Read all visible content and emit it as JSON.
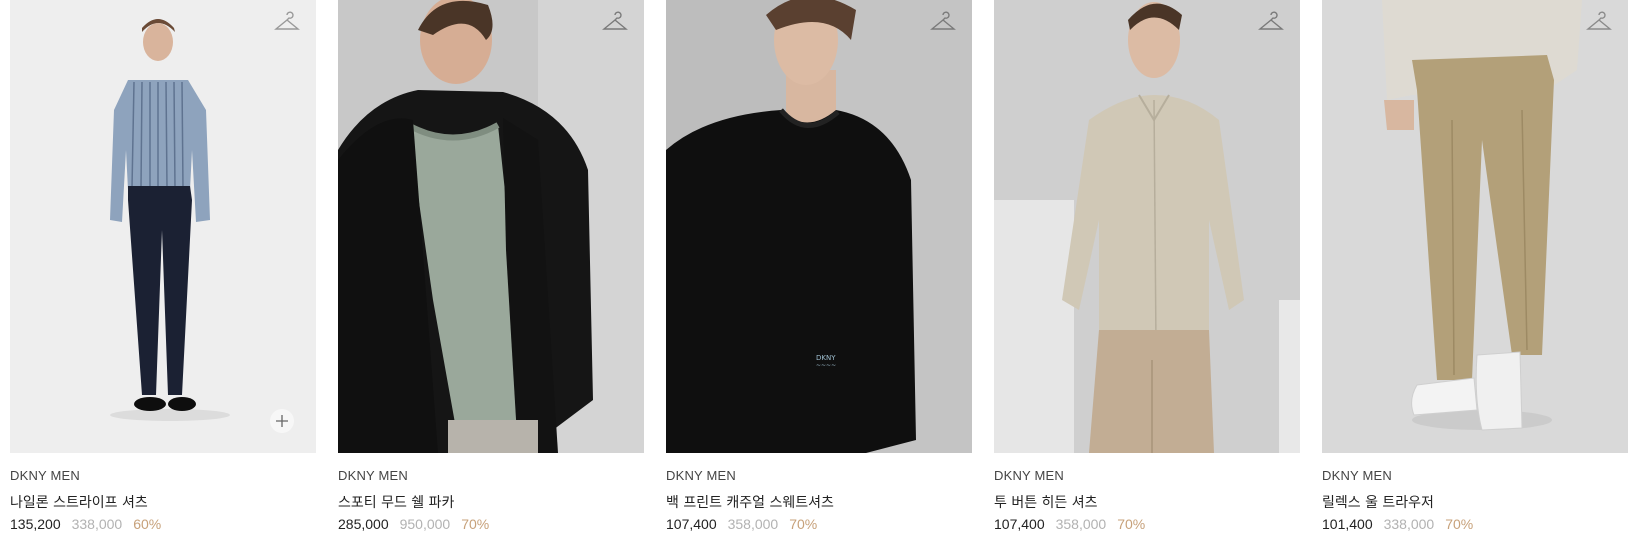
{
  "colors": {
    "discount": "#c7a17a",
    "original_price": "#b2b2b2"
  },
  "products": [
    {
      "brand": "DKNY MEN",
      "name": "나일론 스트라이프 셔츠",
      "price": "135,200",
      "original_price": "338,000",
      "discount": "60%",
      "icons": [
        "hanger-icon",
        "plus-icon"
      ]
    },
    {
      "brand": "DKNY MEN",
      "name": "스포티 무드 쉘 파카",
      "price": "285,000",
      "original_price": "950,000",
      "discount": "70%",
      "icons": [
        "hanger-icon"
      ]
    },
    {
      "brand": "DKNY MEN",
      "name": "백 프린트 캐주얼 스웨트셔츠",
      "price": "107,400",
      "original_price": "358,000",
      "discount": "70%",
      "icons": [
        "hanger-icon"
      ]
    },
    {
      "brand": "DKNY MEN",
      "name": "투 버튼 히든 셔츠",
      "price": "107,400",
      "original_price": "358,000",
      "discount": "70%",
      "icons": [
        "hanger-icon"
      ]
    },
    {
      "brand": "DKNY MEN",
      "name": "릴렉스 울 트라우저",
      "price": "101,400",
      "original_price": "338,000",
      "discount": "70%",
      "icons": [
        "hanger-icon"
      ]
    }
  ]
}
